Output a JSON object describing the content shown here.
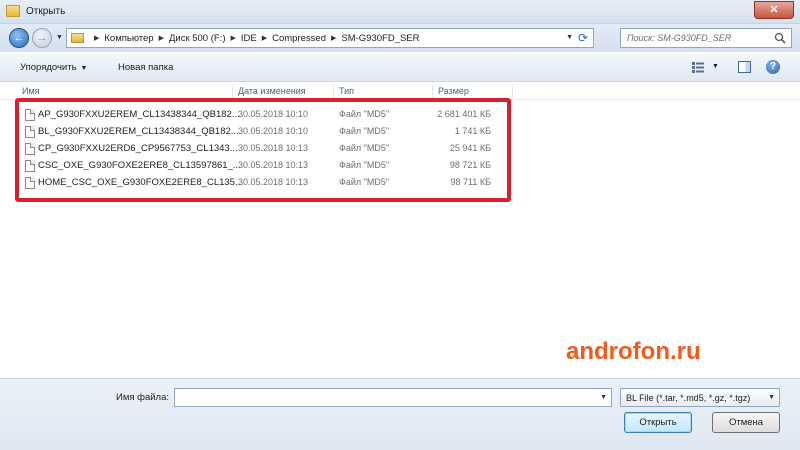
{
  "window": {
    "title": "Открыть",
    "close_label": "✕"
  },
  "navigation": {
    "back_label": "←",
    "forward_label": "→",
    "breadcrumbs": [
      "Компьютер",
      "Диск 500 (F:)",
      "IDE",
      "Compressed",
      "SM-G930FD_SER"
    ],
    "search_placeholder": "Поиск: SM-G930FD_SER"
  },
  "toolbar": {
    "organize_label": "Упорядочить",
    "new_folder_label": "Новая папка",
    "help_label": "?"
  },
  "columns": {
    "name": "Имя",
    "date": "Дата изменения",
    "type": "Тип",
    "size": "Размер"
  },
  "files": [
    {
      "name": "AP_G930FXXU2EREM_CL13438344_QB182...",
      "date": "30.05.2018 10:10",
      "type": "Файл \"MD5\"",
      "size": "2 681 401 КБ"
    },
    {
      "name": "BL_G930FXXU2EREM_CL13438344_QB182...",
      "date": "30.05.2018 10:10",
      "type": "Файл \"MD5\"",
      "size": "1 741 КБ"
    },
    {
      "name": "CP_G930FXXU2ERD6_CP9567753_CL1343...",
      "date": "30.05.2018 10:13",
      "type": "Файл \"MD5\"",
      "size": "25 941 КБ"
    },
    {
      "name": "CSC_OXE_G930FOXE2ERE8_CL13597861_...",
      "date": "30.05.2018 10:13",
      "type": "Файл \"MD5\"",
      "size": "98 721 КБ"
    },
    {
      "name": "HOME_CSC_OXE_G930FOXE2ERE8_CL135...",
      "date": "30.05.2018 10:13",
      "type": "Файл \"MD5\"",
      "size": "98 711 КБ"
    }
  ],
  "bottom": {
    "filename_label": "Имя файла:",
    "filename_value": "",
    "filter_value": "BL File (*.tar, *.md5, *.gz, *.tgz)",
    "open_label": "Открыть",
    "cancel_label": "Отмена"
  },
  "watermark": "androfon.ru",
  "colors": {
    "highlight": "#d7212e",
    "watermark": "#f25a1e"
  }
}
